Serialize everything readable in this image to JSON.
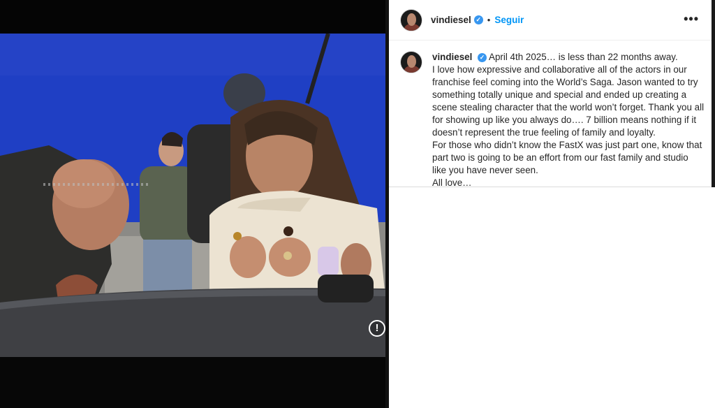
{
  "post": {
    "username": "vindiesel",
    "verified_icon": "verified-badge-icon",
    "separator": "•",
    "follow_label": "Seguir",
    "more_label": "•••",
    "alert_label": "!"
  },
  "caption": {
    "username": "vindiesel",
    "lines": [
      "April 4th 2025… is less than 22 months away.",
      "I love how expressive and collaborative all of the actors in our franchise feel coming into the World’s Saga. Jason wanted to try something totally unique and special and ended up creating a scene stealing character that the world won’t forget. Thank you all for showing up like you always do…. 7 billion means nothing if it doesn’t represent the true feeling of family and loyalty.",
      "For those who didn’t know the FastX was just part one, know that part two is going to be an effort from our fast family and studio like you have never seen.",
      "All love…"
    ]
  },
  "colors": {
    "accent": "#0095f6",
    "verified": "#3897f0",
    "backdrop_blue": "#1f3fc4"
  }
}
